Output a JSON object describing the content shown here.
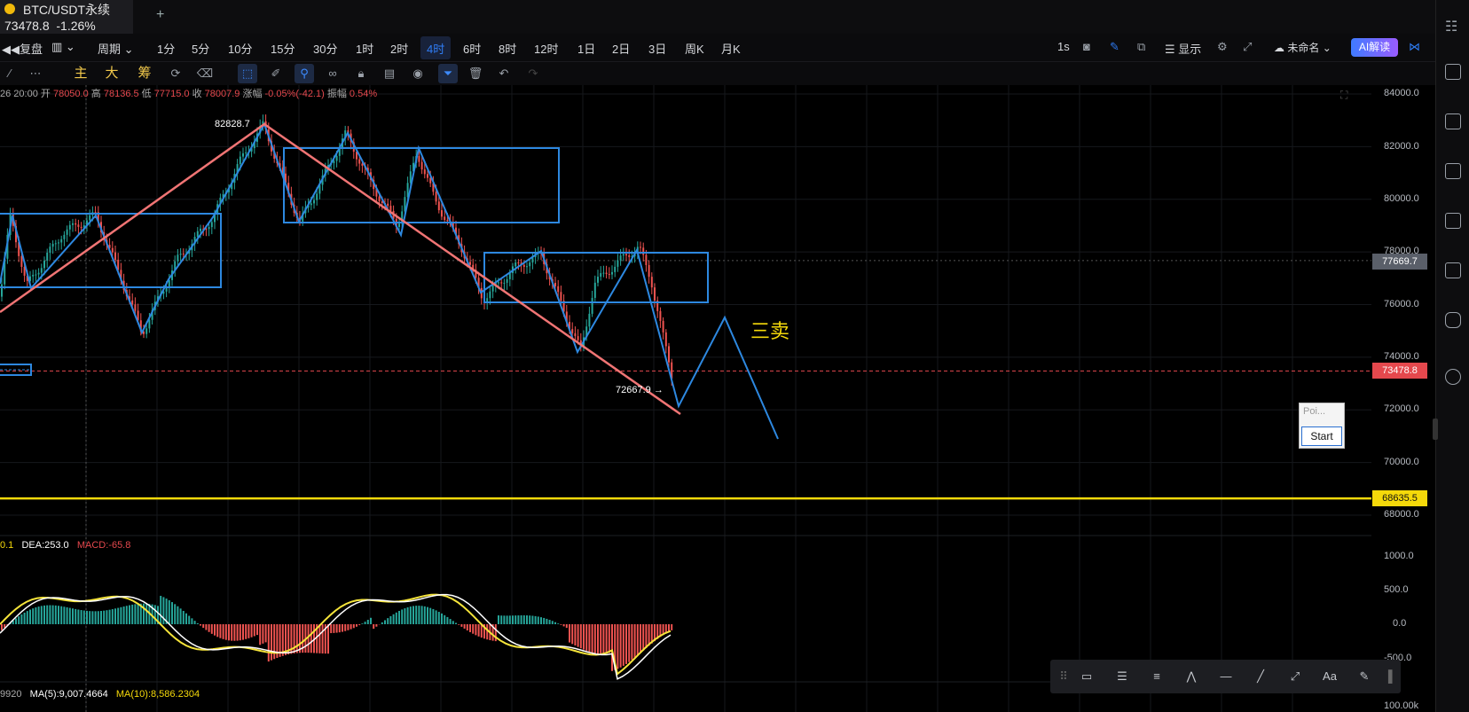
{
  "tab": {
    "title": "BTC/USDT永续",
    "price": "73478.8",
    "change": "-1.26%",
    "add": "+"
  },
  "toolbar": {
    "replay": "复盘",
    "period_label": "周期",
    "intervals": [
      "1分",
      "5分",
      "10分",
      "15分",
      "30分",
      "1时",
      "2时",
      "4时",
      "6时",
      "8时",
      "12时",
      "1日",
      "2日",
      "3日",
      "周K",
      "月K"
    ],
    "active_interval": "4时",
    "speed": "1s",
    "display": "显示",
    "layout_name": "未命名",
    "ai": "AI解读"
  },
  "tools_row": {
    "indicators": [
      "主",
      "大",
      "筹"
    ]
  },
  "ohlc": {
    "time": "26 20:00",
    "open_label": "开",
    "open": "78050.0",
    "high_label": "高",
    "high": "78136.5",
    "low_label": "低",
    "low": "77715.0",
    "close_label": "收",
    "close": "78007.9",
    "chg_label": "涨幅",
    "chg": "-0.05%(-42.1)",
    "amp_label": "振幅",
    "amp": "0.54%"
  },
  "annotations": {
    "high_marker": "82828.7",
    "low_marker": "72667.9 →",
    "sell_text": "三卖"
  },
  "price_axis": [
    "84000.0",
    "82000.0",
    "80000.0",
    "78000.0",
    "76000.0",
    "74000.0",
    "72000.0",
    "70000.0",
    "68000.0"
  ],
  "price_tags": {
    "crosshair": "77669.7",
    "last": "73478.8",
    "support": "68635.5"
  },
  "macd": {
    "dif_fragment": "0.1",
    "dea": "DEA:253.0",
    "macd": "MACD:-65.8",
    "axis": [
      "1000.0",
      "500.0",
      "0.0",
      "-500.0"
    ]
  },
  "volume": {
    "fragment": "9920",
    "ma5": "MA(5):9,007.4664",
    "ma10": "MA(10):8,586.2304",
    "axis_bottom": "100.00k"
  },
  "popup": {
    "placeholder": "Poi...",
    "button": "Start"
  },
  "drawbar": {
    "text_tool": "Aa"
  },
  "colors": {
    "up": "#26a69a",
    "down": "#ef5350",
    "trend_line": "#f07474",
    "structure": "#2d88e0",
    "support": "#f5d90a",
    "accent": "#2f7df6"
  }
}
